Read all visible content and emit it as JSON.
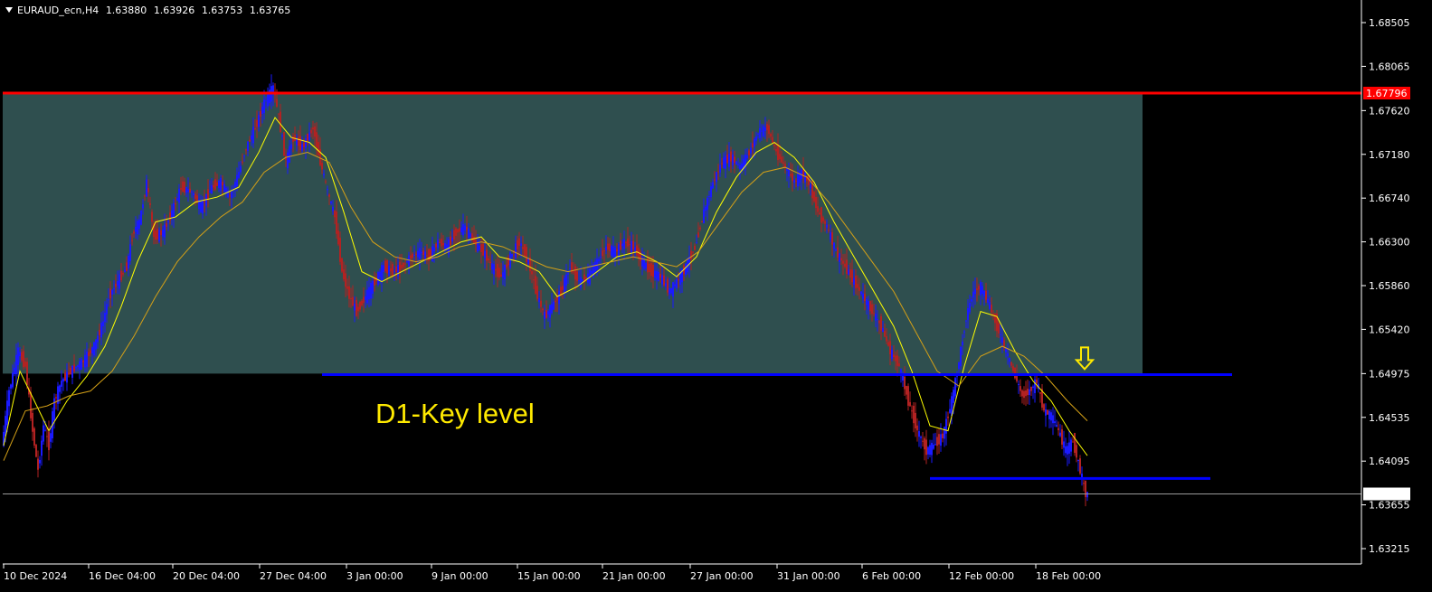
{
  "header": {
    "symbol": "EURAUD_ecn,H4",
    "open": "1.63880",
    "high": "1.63926",
    "low": "1.63753",
    "close": "1.63765"
  },
  "colors": {
    "background": "#000000",
    "bull": "#1a1aff",
    "bear": "#b22222",
    "zone": "#2f4f4f",
    "resistance": "#ff0000",
    "key_level": "#0000ff",
    "ma_fast": "#ffff00",
    "ma_slow": "#d4a017",
    "annotation": "#ffea00"
  },
  "chart_data": {
    "type": "candlestick",
    "symbol": "EURAUD_ecn",
    "timeframe": "H4",
    "ylim": [
      1.62,
      1.6875
    ],
    "y_ticks": [
      "1.68505",
      "1.68065",
      "1.67620",
      "1.67180",
      "1.66740",
      "1.66300",
      "1.65860",
      "1.65420",
      "1.64975",
      "1.64535",
      "1.64095",
      "1.63655",
      "1.63215"
    ],
    "x_ticks": [
      "10 Dec 2024",
      "16 Dec 04:00",
      "20 Dec 04:00",
      "27 Dec 04:00",
      "3 Jan 00:00",
      "9 Jan 00:00",
      "15 Jan 00:00",
      "21 Jan 00:00",
      "27 Jan 00:00",
      "31 Jan 00:00",
      "6 Feb 00:00",
      "12 Feb 00:00",
      "18 Feb 00:00"
    ],
    "price_path": [
      [
        0,
        1.6425
      ],
      [
        8,
        1.648
      ],
      [
        18,
        1.652
      ],
      [
        26,
        1.6505
      ],
      [
        34,
        1.644
      ],
      [
        40,
        1.64
      ],
      [
        46,
        1.6445
      ],
      [
        52,
        1.6425
      ],
      [
        58,
        1.647
      ],
      [
        66,
        1.649
      ],
      [
        76,
        1.65
      ],
      [
        90,
        1.651
      ],
      [
        102,
        1.6525
      ],
      [
        112,
        1.655
      ],
      [
        118,
        1.6575
      ],
      [
        128,
        1.659
      ],
      [
        138,
        1.6605
      ],
      [
        145,
        1.664
      ],
      [
        152,
        1.665
      ],
      [
        160,
        1.669
      ],
      [
        168,
        1.6635
      ],
      [
        178,
        1.664
      ],
      [
        188,
        1.666
      ],
      [
        198,
        1.6685
      ],
      [
        210,
        1.668
      ],
      [
        220,
        1.6665
      ],
      [
        232,
        1.6685
      ],
      [
        242,
        1.669
      ],
      [
        252,
        1.6675
      ],
      [
        262,
        1.67
      ],
      [
        270,
        1.6725
      ],
      [
        280,
        1.6745
      ],
      [
        290,
        1.677
      ],
      [
        300,
        1.6785
      ],
      [
        306,
        1.6755
      ],
      [
        314,
        1.671
      ],
      [
        322,
        1.6735
      ],
      [
        332,
        1.6725
      ],
      [
        344,
        1.6745
      ],
      [
        352,
        1.671
      ],
      [
        360,
        1.668
      ],
      [
        368,
        1.6655
      ],
      [
        376,
        1.66
      ],
      [
        384,
        1.6575
      ],
      [
        392,
        1.656
      ],
      [
        402,
        1.6575
      ],
      [
        412,
        1.659
      ],
      [
        422,
        1.6605
      ],
      [
        432,
        1.66
      ],
      [
        442,
        1.6605
      ],
      [
        452,
        1.6615
      ],
      [
        462,
        1.662
      ],
      [
        472,
        1.6615
      ],
      [
        482,
        1.663
      ],
      [
        492,
        1.6625
      ],
      [
        502,
        1.664
      ],
      [
        512,
        1.6645
      ],
      [
        522,
        1.663
      ],
      [
        532,
        1.662
      ],
      [
        542,
        1.6605
      ],
      [
        552,
        1.6595
      ],
      [
        562,
        1.6615
      ],
      [
        572,
        1.663
      ],
      [
        582,
        1.661
      ],
      [
        592,
        1.6575
      ],
      [
        600,
        1.6555
      ],
      [
        608,
        1.6565
      ],
      [
        618,
        1.658
      ],
      [
        628,
        1.6605
      ],
      [
        638,
        1.659
      ],
      [
        648,
        1.6595
      ],
      [
        658,
        1.661
      ],
      [
        668,
        1.6625
      ],
      [
        678,
        1.662
      ],
      [
        688,
        1.663
      ],
      [
        698,
        1.6625
      ],
      [
        708,
        1.661
      ],
      [
        718,
        1.66
      ],
      [
        728,
        1.6595
      ],
      [
        738,
        1.658
      ],
      [
        746,
        1.659
      ],
      [
        756,
        1.6605
      ],
      [
        766,
        1.6625
      ],
      [
        776,
        1.666
      ],
      [
        786,
        1.669
      ],
      [
        796,
        1.671
      ],
      [
        806,
        1.6715
      ],
      [
        816,
        1.6705
      ],
      [
        826,
        1.672
      ],
      [
        836,
        1.674
      ],
      [
        846,
        1.6745
      ],
      [
        856,
        1.672
      ],
      [
        866,
        1.6705
      ],
      [
        876,
        1.669
      ],
      [
        884,
        1.67
      ],
      [
        892,
        1.669
      ],
      [
        902,
        1.666
      ],
      [
        912,
        1.6645
      ],
      [
        922,
        1.662
      ],
      [
        932,
        1.6605
      ],
      [
        942,
        1.659
      ],
      [
        952,
        1.6575
      ],
      [
        962,
        1.656
      ],
      [
        972,
        1.6545
      ],
      [
        982,
        1.652
      ],
      [
        992,
        1.6505
      ],
      [
        1002,
        1.647
      ],
      [
        1012,
        1.644
      ],
      [
        1022,
        1.642
      ],
      [
        1030,
        1.6425
      ],
      [
        1040,
        1.6435
      ],
      [
        1050,
        1.647
      ],
      [
        1058,
        1.651
      ],
      [
        1066,
        1.6555
      ],
      [
        1074,
        1.658
      ],
      [
        1082,
        1.6585
      ],
      [
        1090,
        1.657
      ],
      [
        1100,
        1.6545
      ],
      [
        1110,
        1.652
      ],
      [
        1120,
        1.6495
      ],
      [
        1128,
        1.6475
      ],
      [
        1136,
        1.648
      ],
      [
        1144,
        1.649
      ],
      [
        1152,
        1.646
      ],
      [
        1160,
        1.6455
      ],
      [
        1168,
        1.644
      ],
      [
        1176,
        1.642
      ],
      [
        1184,
        1.643
      ],
      [
        1192,
        1.64
      ],
      [
        1198,
        1.63765
      ]
    ],
    "moving_averages": [
      {
        "style": "fast",
        "values": [
          [
            0,
            1.6425
          ],
          [
            18,
            1.65
          ],
          [
            34,
            1.647
          ],
          [
            50,
            1.644
          ],
          [
            70,
            1.647
          ],
          [
            92,
            1.6495
          ],
          [
            112,
            1.6525
          ],
          [
            130,
            1.6565
          ],
          [
            148,
            1.661
          ],
          [
            168,
            1.665
          ],
          [
            190,
            1.6655
          ],
          [
            212,
            1.667
          ],
          [
            236,
            1.6675
          ],
          [
            260,
            1.6685
          ],
          [
            282,
            1.672
          ],
          [
            300,
            1.6755
          ],
          [
            318,
            1.6735
          ],
          [
            338,
            1.673
          ],
          [
            356,
            1.6715
          ],
          [
            376,
            1.666
          ],
          [
            396,
            1.66
          ],
          [
            418,
            1.659
          ],
          [
            440,
            1.66
          ],
          [
            462,
            1.661
          ],
          [
            484,
            1.662
          ],
          [
            506,
            1.663
          ],
          [
            528,
            1.6635
          ],
          [
            548,
            1.6615
          ],
          [
            570,
            1.661
          ],
          [
            592,
            1.66
          ],
          [
            612,
            1.6575
          ],
          [
            634,
            1.6585
          ],
          [
            656,
            1.66
          ],
          [
            678,
            1.6615
          ],
          [
            700,
            1.662
          ],
          [
            722,
            1.661
          ],
          [
            744,
            1.6595
          ],
          [
            766,
            1.6615
          ],
          [
            788,
            1.666
          ],
          [
            810,
            1.6695
          ],
          [
            832,
            1.672
          ],
          [
            852,
            1.673
          ],
          [
            874,
            1.6715
          ],
          [
            896,
            1.669
          ],
          [
            918,
            1.665
          ],
          [
            940,
            1.6615
          ],
          [
            962,
            1.658
          ],
          [
            984,
            1.6545
          ],
          [
            1004,
            1.65
          ],
          [
            1024,
            1.6445
          ],
          [
            1044,
            1.644
          ],
          [
            1062,
            1.6505
          ],
          [
            1080,
            1.656
          ],
          [
            1098,
            1.6555
          ],
          [
            1118,
            1.652
          ],
          [
            1138,
            1.649
          ],
          [
            1158,
            1.647
          ],
          [
            1178,
            1.644
          ],
          [
            1198,
            1.6415
          ]
        ]
      },
      {
        "style": "slow",
        "values": [
          [
            0,
            1.641
          ],
          [
            24,
            1.646
          ],
          [
            48,
            1.6465
          ],
          [
            72,
            1.6475
          ],
          [
            96,
            1.648
          ],
          [
            120,
            1.65
          ],
          [
            144,
            1.6535
          ],
          [
            168,
            1.6575
          ],
          [
            192,
            1.661
          ],
          [
            216,
            1.6635
          ],
          [
            240,
            1.6655
          ],
          [
            264,
            1.667
          ],
          [
            288,
            1.67
          ],
          [
            312,
            1.6715
          ],
          [
            336,
            1.672
          ],
          [
            360,
            1.671
          ],
          [
            384,
            1.6665
          ],
          [
            408,
            1.663
          ],
          [
            432,
            1.6615
          ],
          [
            456,
            1.661
          ],
          [
            480,
            1.6615
          ],
          [
            504,
            1.6625
          ],
          [
            528,
            1.663
          ],
          [
            552,
            1.6625
          ],
          [
            576,
            1.6615
          ],
          [
            600,
            1.6605
          ],
          [
            624,
            1.66
          ],
          [
            648,
            1.6605
          ],
          [
            672,
            1.661
          ],
          [
            696,
            1.6615
          ],
          [
            720,
            1.661
          ],
          [
            744,
            1.6605
          ],
          [
            768,
            1.662
          ],
          [
            792,
            1.665
          ],
          [
            816,
            1.668
          ],
          [
            840,
            1.67
          ],
          [
            864,
            1.6705
          ],
          [
            888,
            1.6695
          ],
          [
            912,
            1.667
          ],
          [
            936,
            1.664
          ],
          [
            960,
            1.661
          ],
          [
            984,
            1.658
          ],
          [
            1008,
            1.654
          ],
          [
            1032,
            1.65
          ],
          [
            1056,
            1.6485
          ],
          [
            1080,
            1.6515
          ],
          [
            1104,
            1.6525
          ],
          [
            1128,
            1.6515
          ],
          [
            1152,
            1.6495
          ],
          [
            1176,
            1.647
          ],
          [
            1198,
            1.645
          ]
        ]
      }
    ],
    "resistance": {
      "value": 1.67796,
      "label": "1.67796"
    },
    "zone": {
      "top": 1.67796,
      "bottom": 1.64975
    },
    "key_levels": [
      {
        "value": 1.64965,
        "from": 352,
        "to": 1358
      },
      {
        "value": 1.6392,
        "from": 1024,
        "to": 1334
      }
    ],
    "current_price": {
      "value": 1.63765,
      "label": "1.63765"
    },
    "annotations": [
      {
        "text": "D1-Key level"
      }
    ],
    "signal": {
      "type": "down-arrow",
      "at_x": 1195,
      "value": 1.6502
    }
  }
}
